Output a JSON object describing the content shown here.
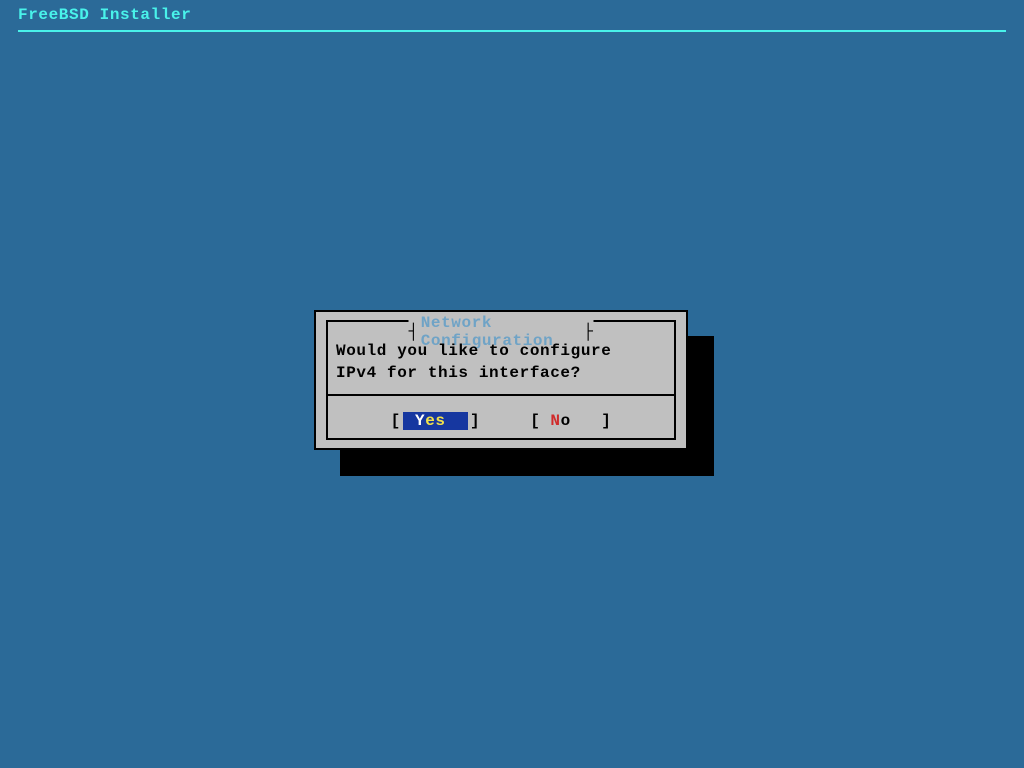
{
  "header": {
    "title": "FreeBSD Installer"
  },
  "dialog": {
    "title": "Network Configuration",
    "body_line1": "Would you like to configure",
    "body_line2": "IPv4 for this interface?",
    "buttons": {
      "yes": {
        "open": "[",
        "accel": "Y",
        "rest": "es",
        "close": "]",
        "selected": true
      },
      "no": {
        "open": "[",
        "accel": "N",
        "rest": "o",
        "close": "]",
        "selected": false
      }
    }
  }
}
